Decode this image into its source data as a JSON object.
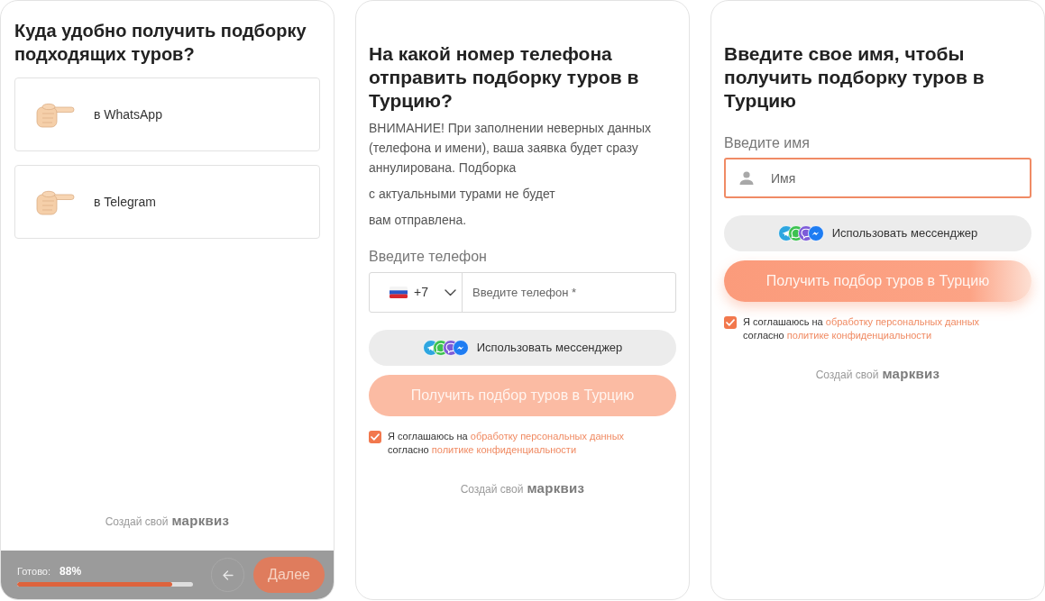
{
  "screens": [
    {
      "kind": "choice",
      "heading": "Куда удобно получить подборку подходящих туров?",
      "options": [
        {
          "label": "в WhatsApp",
          "selected": false
        },
        {
          "label": "в Telegram",
          "selected": false
        }
      ],
      "footer": {
        "prefix": "Создай свой",
        "brand": "марквиз"
      },
      "progress": {
        "label": "Готово:",
        "value": "88%",
        "level": 0.88
      },
      "next_button": "Далее"
    },
    {
      "kind": "phone",
      "heading": "На какой номер телефона отправить подборку туров в Турцию?",
      "notice": [
        "ВНИМАНИЕ! При заполнении неверных данных (телефона и имени), ваша заявка будет сразу аннулирована. Подборка",
        "с актуальными турами не будет",
        "вам отправлена."
      ],
      "field": {
        "label": "Введите телефон",
        "country_code": "+7",
        "placeholder": "Введите телефон *",
        "focused": false
      },
      "messenger_button": "Использовать мессенджер",
      "submit": {
        "label": "Получить подбор туров в Турцию",
        "disabled": true
      },
      "consent": {
        "checked": true,
        "lines": [
          [
            {
              "kind": "text",
              "text": "Я соглашаюсь на"
            },
            {
              "kind": "link",
              "text": "обработку персональных данных"
            }
          ],
          [
            {
              "kind": "text",
              "text": "согласно"
            },
            {
              "kind": "link",
              "text": "политике конфиденциальности"
            }
          ]
        ]
      },
      "footer": {
        "prefix": "Создай свой",
        "brand": "марквиз"
      }
    },
    {
      "kind": "name",
      "heading": "Введите свое имя, чтобы получить подборку туров в Турцию",
      "field": {
        "label": "Введите имя",
        "placeholder": "Имя",
        "focused": true
      },
      "messenger_button": "Использовать мессенджер",
      "submit": {
        "label": "Получить подбор туров в Турцию",
        "disabled": false
      },
      "consent": {
        "checked": true,
        "lines": [
          [
            {
              "kind": "text",
              "text": "Я соглашаюсь на"
            },
            {
              "kind": "link",
              "text": "обработку персональных данных"
            }
          ],
          [
            {
              "kind": "text",
              "text": "согласно"
            },
            {
              "kind": "link",
              "text": "политике конфиденциальности"
            }
          ]
        ]
      },
      "footer": {
        "prefix": "Создай свой",
        "brand": "марквиз"
      }
    }
  ]
}
